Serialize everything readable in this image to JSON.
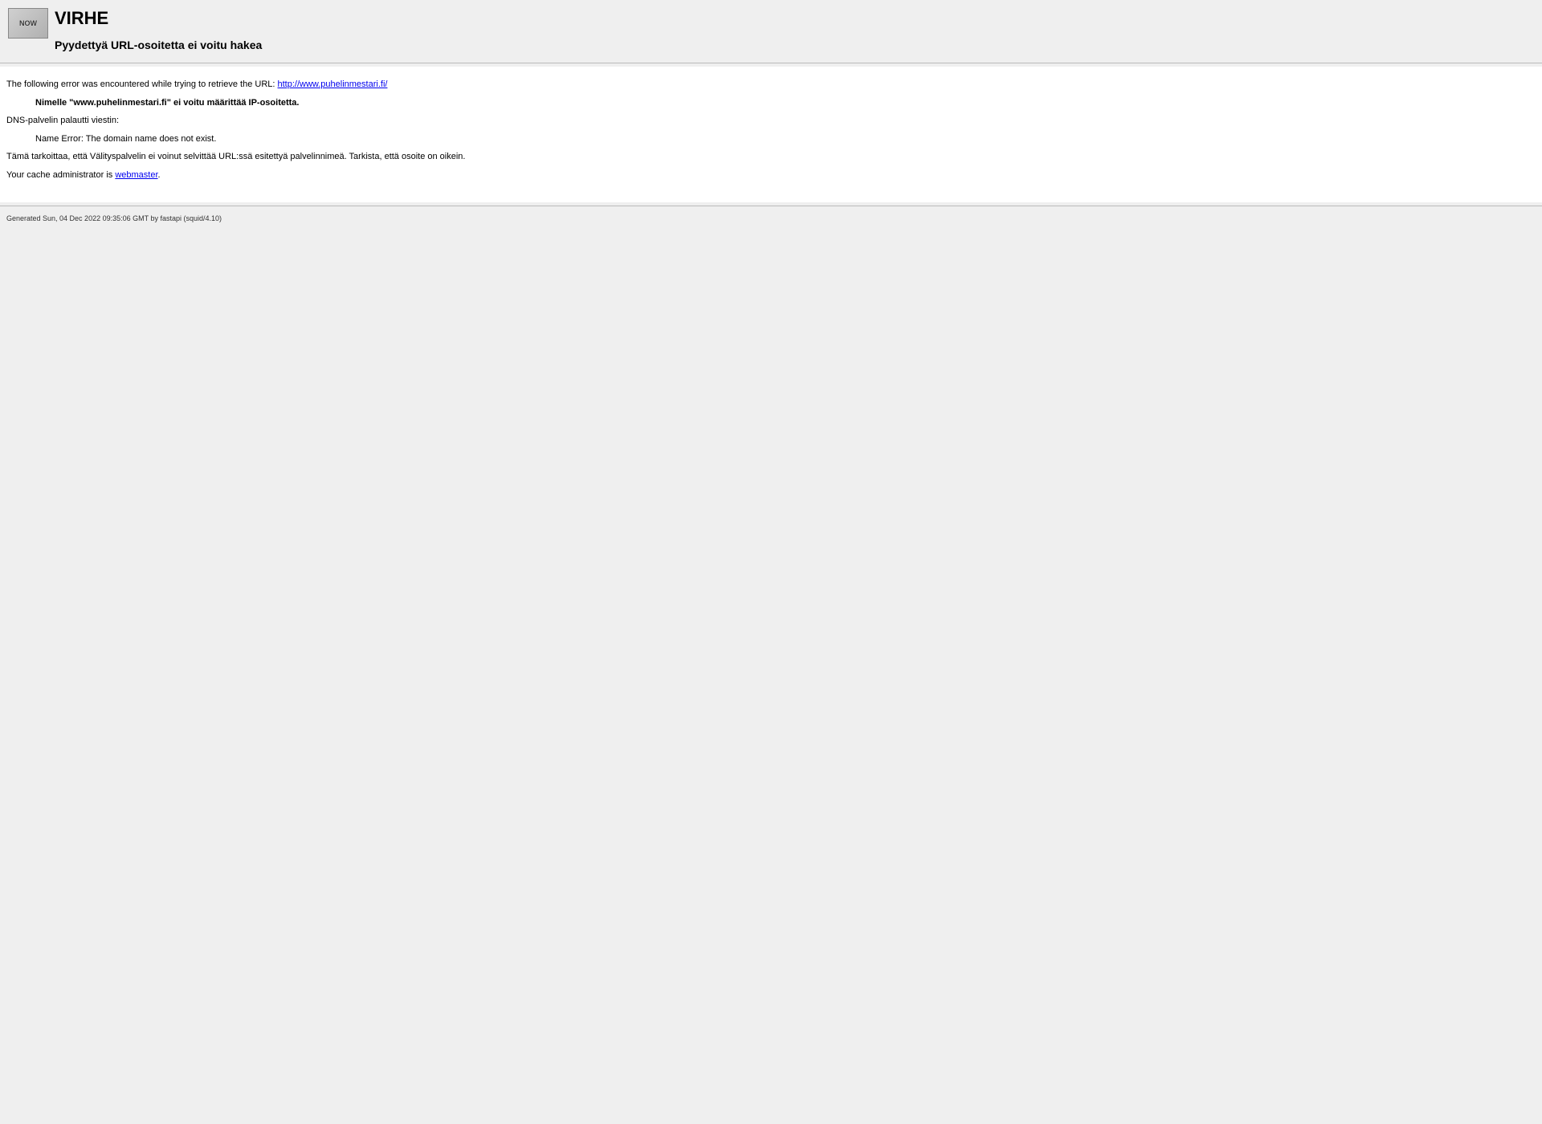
{
  "header": {
    "icon_label": "NOW",
    "title": "VIRHE",
    "subtitle": "Pyydettyä URL-osoitetta ei voitu hakea"
  },
  "content": {
    "intro_text": "The following error was encountered while trying to retrieve the URL: ",
    "url": "http://www.puhelinmestari.fi/",
    "error_bold": "Nimelle \"www.puhelinmestari.fi\" ei voitu määrittää IP-osoitetta.",
    "dns_text": "DNS-palvelin palautti viestin:",
    "dns_error": "Name Error: The domain name does not exist.",
    "explanation": "Tämä tarkoittaa, että Välityspalvelin ei voinut selvittää URL:ssä esitettyä palvelinnimeä. Tarkista, että osoite on oikein.",
    "admin_text": "Your cache administrator is ",
    "admin_link": "webmaster",
    "admin_suffix": "."
  },
  "footer": {
    "generated": "Generated Sun, 04 Dec 2022 09:35:06 GMT by fastapi (squid/4.10)"
  }
}
